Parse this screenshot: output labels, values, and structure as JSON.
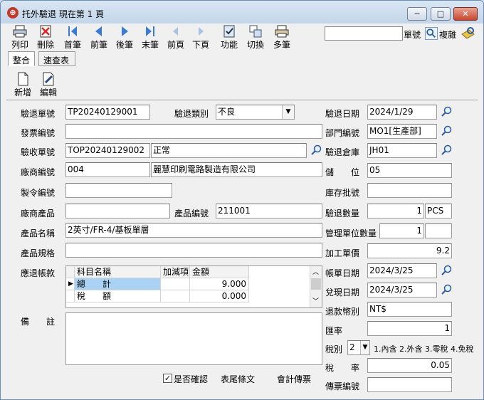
{
  "window": {
    "title": "托外驗退  現在第 1 頁",
    "minimize": "─",
    "maximize": "□",
    "close": "✕"
  },
  "toolbar": {
    "items": [
      {
        "label": "列印",
        "icon": "printer-icon"
      },
      {
        "label": "刪除",
        "icon": "delete-icon"
      },
      {
        "label": "首筆",
        "icon": "first-record-icon"
      },
      {
        "label": "前筆",
        "icon": "previous-record-icon"
      },
      {
        "label": "後筆",
        "icon": "next-record-icon"
      },
      {
        "label": "末筆",
        "icon": "last-record-icon"
      },
      {
        "label": "前頁",
        "icon": "previous-page-icon"
      },
      {
        "label": "下頁",
        "icon": "next-page-icon"
      },
      {
        "label": "功能",
        "icon": "function-icon"
      },
      {
        "label": "切換",
        "icon": "switch-icon"
      },
      {
        "label": "多筆",
        "icon": "multi-record-icon"
      }
    ],
    "search_value": "",
    "search_label": "單號",
    "complex_label": "複雜"
  },
  "tabs": {
    "integrate": "整合",
    "quick_table": "速查表"
  },
  "subtoolbar": {
    "add": "新增",
    "edit": "編輯"
  },
  "form": {
    "return_no_label": "驗退單號",
    "return_no": "TP20240129001",
    "return_type_label": "驗退類別",
    "return_type": "不良",
    "return_date_label": "驗退日期",
    "return_date": "2024/1/29",
    "invoice_no_label": "發票編號",
    "invoice_no": "",
    "dept_no_label": "部門編號",
    "dept_no": "MO1[生產部]",
    "receipt_no_label": "驗收單號",
    "receipt_no": "TOP20240129002",
    "receipt_status": "正常",
    "warehouse_label": "驗退倉庫",
    "warehouse": "JH01",
    "vendor_no_label": "廠商編號",
    "vendor_no": "004",
    "vendor_name": "麗慧印刷電路製造有限公司",
    "storage_label": "儲　　位",
    "storage": "05",
    "mo_no_label": "製令編號",
    "mo_no": "",
    "lot_no_label": "庫存批號",
    "lot_no": "",
    "vendor_product_label": "廠商產品",
    "vendor_product": "",
    "product_no_label": "產品編號",
    "product_no": "211001",
    "return_qty_label": "驗退數量",
    "return_qty": "1",
    "unit": "PCS",
    "product_name_label": "產品名稱",
    "product_name": "2英寸/FR-4/基板單層",
    "mgmt_qty_label": "管理單位數量",
    "mgmt_qty": "1",
    "mgmt_unit": "",
    "product_spec_label": "產品規格",
    "product_spec": "",
    "unit_price_label": "加工單價",
    "unit_price": "9.2",
    "payable_label": "應退帳款",
    "account_date_label": "帳單日期",
    "account_date": "2024/3/25",
    "cash_date_label": "兌現日期",
    "cash_date": "2024/3/25",
    "currency_label": "退款幣別",
    "currency": "NT$",
    "rate_label": "匯率",
    "rate": "1",
    "tax_type_label": "稅別",
    "tax_type": "2",
    "tax_type_hint": "1.內含 2.外含 3.零稅 4.免稅",
    "tax_rate_label": "稅　　率",
    "tax_rate": "0.05",
    "voucher_no_label": "傳票編號",
    "voucher_no": "",
    "memo_label": "備　　註",
    "memo": "",
    "confirmed_label": "是否確認",
    "footer_text_label": "表尾條文",
    "accounting_label": "會計傳票"
  },
  "grid": {
    "headers": [
      "科目名稱",
      "加減項",
      "金額"
    ],
    "rows": [
      {
        "name": "總　　計",
        "sign": "",
        "amount": "9.000"
      },
      {
        "name": "稅　　額",
        "sign": "",
        "amount": "0.000"
      }
    ]
  }
}
